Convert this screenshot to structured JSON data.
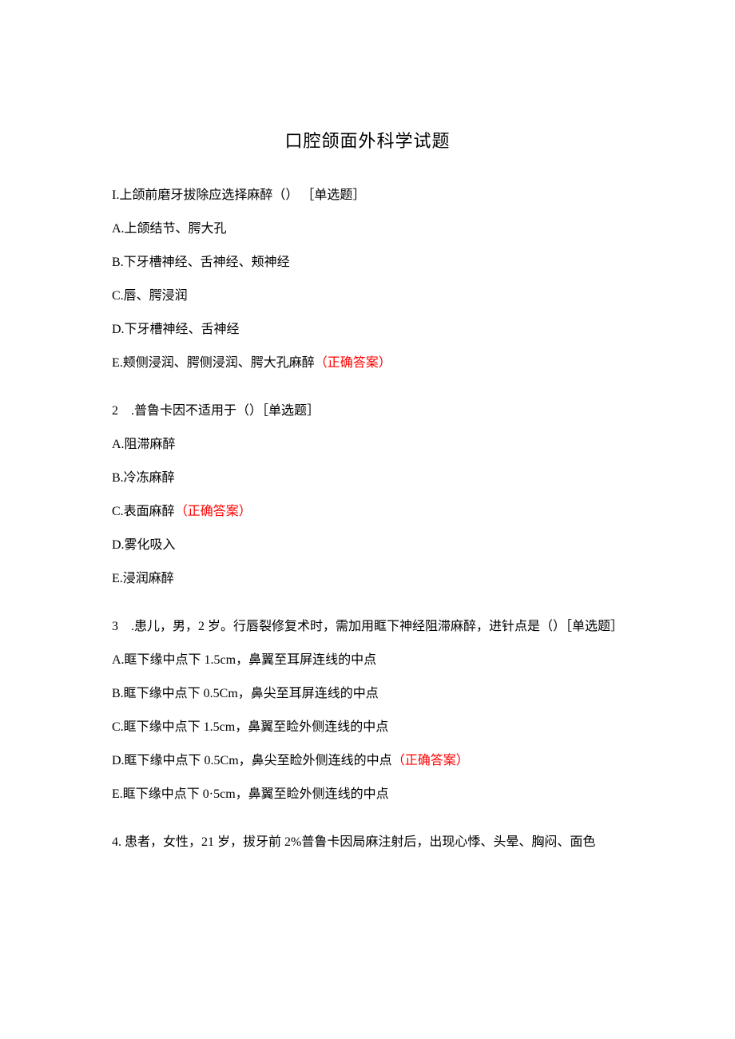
{
  "title": "口腔颌面外科学试题",
  "q1": {
    "prompt": "I.上颌前磨牙拔除应选择麻醉（） ［单选题］",
    "a": "A.上颌结节、腭大孔",
    "b": "B.下牙槽神经、舌神经、颊神经",
    "c": "C.唇、腭浸润",
    "d": "D.下牙槽神经、舌神经",
    "e": "E.颊侧浸润、腭侧浸润、腭大孔麻醉",
    "e_correct": "（正确答案）"
  },
  "q2": {
    "prompt": "2 .普鲁卡因不适用于（）［单选题］",
    "a": "A.阻滞麻醉",
    "b": "B.冷冻麻醉",
    "c": "C.表面麻醉",
    "c_correct": "（正确答案）",
    "d": "D.雾化吸入",
    "e": "E.浸润麻醉"
  },
  "q3": {
    "prompt": "3 .患儿，男，2 岁。行唇裂修复术时，需加用眶下神经阻滞麻醉，进针点是（）［单选题］",
    "a": "A.眶下缘中点下 1.5cm，鼻翼至耳屏连线的中点",
    "b": "B.眶下缘中点下 0.5Cm，鼻尖至耳屏连线的中点",
    "c": "C.眶下缘中点下 1.5cm，鼻翼至睑外侧连线的中点",
    "d": "D.眶下缘中点下 0.5Cm，鼻尖至睑外侧连线的中点",
    "d_correct": "（正确答案）",
    "e": "E.眶下缘中点下 0·5cm，鼻翼至睑外侧连线的中点"
  },
  "q4": {
    "prompt": "4. 患者，女性，21 岁，拔牙前 2%普鲁卡因局麻注射后，出现心悸、头晕、胸闷、面色"
  }
}
